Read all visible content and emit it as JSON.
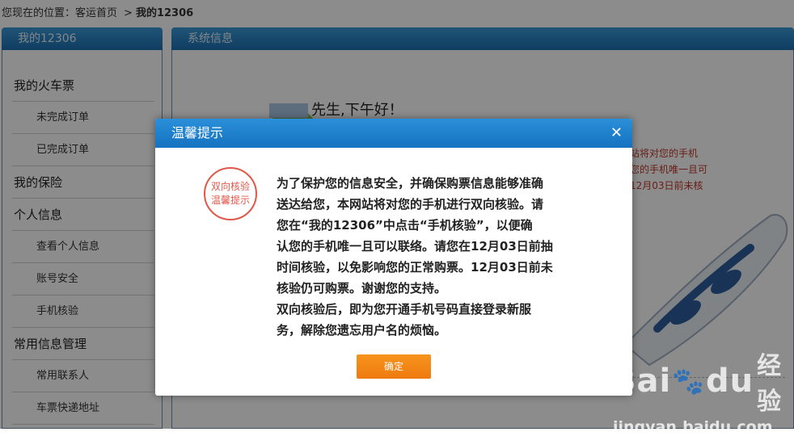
{
  "breadcrumb": {
    "location_label": "您现在的位置：",
    "home": "客运首页",
    "separator": ">",
    "current": "我的12306"
  },
  "sidebar": {
    "title": "我的12306",
    "items": [
      {
        "label": "我的火车票",
        "level": "group"
      },
      {
        "label": "未完成订单",
        "level": "sub"
      },
      {
        "label": "已完成订单",
        "level": "sub"
      },
      {
        "label": "我的保险",
        "level": "group"
      },
      {
        "label": "个人信息",
        "level": "group"
      },
      {
        "label": "查看个人信息",
        "level": "sub"
      },
      {
        "label": "账号安全",
        "level": "sub"
      },
      {
        "label": "手机核验",
        "level": "sub"
      },
      {
        "label": "常用信息管理",
        "level": "group"
      },
      {
        "label": "常用联系人",
        "level": "sub"
      },
      {
        "label": "车票快递地址",
        "level": "sub"
      }
    ]
  },
  "main": {
    "title": "系统信息",
    "greeting": "先生,下午好！",
    "side_lines": [
      "站将对您的手机",
      "您的手机唯一且可",
      "12月03日前未核"
    ]
  },
  "dialog": {
    "title": "温馨提示",
    "close_icon": "close-icon",
    "stamp_lines": [
      "双向核验",
      "温馨提示"
    ],
    "message_lines": [
      "为了保护您的信息安全，并确保购票信息能够准确",
      "送达给您，本网站将对您的手机进行双向核验。请",
      "您在“我的12306”中点击“手机核验”，以便确",
      "认您的手机唯一且可以联络。请您在12月03日前抽",
      "时间核验，以免影响您的正常购票。12月03日前未",
      "核验仍可购票。谢谢您的支持。",
      "双向核验后，即为您开通手机号码直接登录新服",
      "务，解除您遗忘用户名的烦恼。"
    ],
    "ok_label": "确定"
  },
  "watermark": {
    "brand_left": "Bai",
    "brand_right": "du",
    "product": "经验",
    "url": "jingyan.baidu.com"
  },
  "colors": {
    "header_blue": "#1c6fb0",
    "button_orange": "#f7941d",
    "stamp_red": "#e0584a"
  }
}
